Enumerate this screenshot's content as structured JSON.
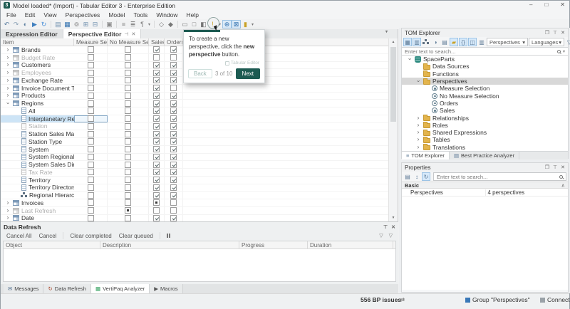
{
  "window": {
    "title": "Model loaded* (Import) - Tabular Editor 3 - Enterprise Edition",
    "controls": {
      "minimize": "–",
      "maximize": "□",
      "close": "✕"
    }
  },
  "menu": [
    "File",
    "Edit",
    "View",
    "Perspectives",
    "Model",
    "Tools",
    "Window",
    "Help"
  ],
  "toolbar": {
    "icons": [
      {
        "name": "undo",
        "glyph": "↶",
        "color": "#5b7ea0"
      },
      {
        "name": "redo",
        "glyph": "↷",
        "color": "#8aa0b5"
      },
      {
        "name": "compare-model",
        "glyph": "◐",
        "color": "#5b7ea0"
      },
      {
        "name": "deploy",
        "glyph": "▶",
        "color": "#3f7fbf"
      },
      {
        "name": "refresh-model",
        "glyph": "↻",
        "color": "#4a90d9"
      },
      {
        "sep": true
      },
      {
        "name": "new-measure",
        "glyph": "▤",
        "color": "#6f8fae"
      },
      {
        "name": "new-calculated-column",
        "glyph": "▦",
        "color": "#2f6fae"
      },
      {
        "name": "new-calculation-group",
        "glyph": "⊚",
        "color": "#888888"
      },
      {
        "name": "add-column",
        "glyph": "⊞",
        "color": "#6f8fae"
      },
      {
        "name": "new-table",
        "glyph": "⊟",
        "color": "#6f8fae"
      },
      {
        "sep": true
      },
      {
        "name": "copy",
        "glyph": "▣",
        "color": "#888888"
      },
      {
        "sep": true
      },
      {
        "name": "format-dax",
        "glyph": "≡",
        "color": "#888888"
      },
      {
        "name": "format-dax-long",
        "glyph": "≣",
        "color": "#888888"
      },
      {
        "name": "format-options",
        "glyph": "¶",
        "color": "#888888",
        "dropdown": true
      },
      {
        "sep": true
      },
      {
        "name": "job-queue",
        "glyph": "◇",
        "color": "#777777"
      },
      {
        "name": "import-tables",
        "glyph": "◆",
        "color": "#777777"
      },
      {
        "sep": true
      },
      {
        "name": "diagram-view",
        "glyph": "▭",
        "color": "#777777"
      },
      {
        "name": "pivot-grid",
        "glyph": "□",
        "color": "#777777"
      },
      {
        "name": "dax-query",
        "glyph": "◧",
        "color": "#777777"
      },
      {
        "name": "best-practice",
        "glyph": "!",
        "color": "#c9a227",
        "dropdown": true
      },
      {
        "name": "new-perspective",
        "glyph": "⊕",
        "color": "#2f6fae",
        "boxed": true,
        "circled": true
      },
      {
        "name": "new-translation",
        "glyph": "⊠",
        "color": "#2f6fae",
        "boxed": true
      },
      {
        "name": "macros",
        "glyph": "▮",
        "color": "#c9a227",
        "dropdown": true
      }
    ]
  },
  "editor_tabs": {
    "tabs": [
      {
        "label": "Expression Editor",
        "active": false
      },
      {
        "label": "Perspective Editor",
        "active": true,
        "pin": "⊣",
        "close": "✕"
      }
    ],
    "overflow_glyph": "▾"
  },
  "perspective_grid": {
    "columns": [
      "Item",
      "Measure Selection",
      "No Measure Selection",
      "Sales",
      "Orders"
    ],
    "rows": [
      {
        "label": "Brands",
        "icon": "table",
        "level": 0,
        "expander": "collapsed",
        "checks": [
          "u",
          "u",
          "c",
          "c"
        ]
      },
      {
        "label": "Budget Rate",
        "icon": "table",
        "level": 0,
        "expander": "collapsed",
        "gray": true,
        "checks": [
          "u",
          "u",
          "u",
          "u"
        ]
      },
      {
        "label": "Customers",
        "icon": "table",
        "level": 0,
        "expander": "collapsed",
        "checks": [
          "u",
          "u",
          "c",
          "c"
        ]
      },
      {
        "label": "Employees",
        "icon": "table",
        "level": 0,
        "expander": "collapsed",
        "gray": true,
        "checks": [
          "u",
          "u",
          "c",
          "c"
        ]
      },
      {
        "label": "Exchange Rate",
        "icon": "table",
        "level": 0,
        "expander": "collapsed",
        "checks": [
          "u",
          "u",
          "c",
          "c"
        ]
      },
      {
        "label": "Invoice Document Type",
        "icon": "table",
        "level": 0,
        "expander": "collapsed",
        "checks": [
          "u",
          "u",
          "c",
          "u"
        ]
      },
      {
        "label": "Products",
        "icon": "table",
        "level": 0,
        "expander": "collapsed",
        "checks": [
          "u",
          "u",
          "c",
          "c"
        ]
      },
      {
        "label": "Regions",
        "icon": "table",
        "level": 0,
        "expander": "expanded",
        "checks": [
          "u",
          "u",
          "c",
          "c"
        ]
      },
      {
        "label": "All",
        "icon": "column",
        "level": 1,
        "checks": [
          "u",
          "u",
          "c",
          "c"
        ]
      },
      {
        "label": "Interplanetary Region",
        "icon": "column",
        "level": 1,
        "selected": true,
        "checks": [
          "u",
          "u",
          "c",
          "c"
        ]
      },
      {
        "label": "Station",
        "icon": "column",
        "level": 1,
        "gray": true,
        "checks": [
          "u",
          "u",
          "c",
          "c"
        ]
      },
      {
        "label": "Station Sales Managers",
        "icon": "column",
        "level": 1,
        "checks": [
          "u",
          "u",
          "c",
          "c"
        ]
      },
      {
        "label": "Station Type",
        "icon": "column",
        "level": 1,
        "checks": [
          "u",
          "u",
          "c",
          "c"
        ]
      },
      {
        "label": "System",
        "icon": "column",
        "level": 1,
        "checks": [
          "u",
          "u",
          "c",
          "c"
        ]
      },
      {
        "label": "System Regional Managers",
        "icon": "column",
        "level": 1,
        "checks": [
          "u",
          "u",
          "c",
          "c"
        ]
      },
      {
        "label": "System Sales Directors",
        "icon": "column",
        "level": 1,
        "checks": [
          "u",
          "u",
          "c",
          "c"
        ]
      },
      {
        "label": "Tax Rate",
        "icon": "column",
        "level": 1,
        "gray": true,
        "checks": [
          "u",
          "u",
          "c",
          "c"
        ]
      },
      {
        "label": "Territory",
        "icon": "column",
        "level": 1,
        "checks": [
          "u",
          "u",
          "c",
          "c"
        ]
      },
      {
        "label": "Territory Directors",
        "icon": "column",
        "level": 1,
        "checks": [
          "u",
          "u",
          "c",
          "c"
        ]
      },
      {
        "label": "Regional Hierarchy",
        "icon": "hierarchy",
        "level": 1,
        "checks": [
          "u",
          "u",
          "c",
          "c"
        ]
      },
      {
        "label": "Invoices",
        "icon": "table",
        "level": 0,
        "expander": "collapsed",
        "checks": [
          "u",
          "u",
          "m",
          "u"
        ]
      },
      {
        "label": "Last Refresh",
        "icon": "table",
        "level": 0,
        "expander": "collapsed",
        "gray": true,
        "checks": [
          "u",
          "m",
          "u",
          "u"
        ]
      },
      {
        "label": "Date",
        "icon": "table",
        "level": 0,
        "expander": "collapsed",
        "checks": [
          "u",
          "u",
          "c",
          "c"
        ]
      }
    ]
  },
  "tour_popup": {
    "text_prefix": "To create a new perspective, click the ",
    "text_bold": "new perspective",
    "text_suffix": " button.",
    "watermark": "Tabular Editor",
    "back_label": "Back",
    "step_label": "3 of 10",
    "next_label": "Next",
    "progress_percent": 45,
    "accent_color": "#1d5b52"
  },
  "tom_explorer": {
    "title": "TOM Explorer",
    "window_icons": {
      "maximize": "❐",
      "pin": "⊤",
      "close": "✕"
    },
    "toolbar_icons": [
      {
        "name": "show-tables",
        "glyph": "▦",
        "active": true
      },
      {
        "name": "show-columns",
        "glyph": "▥",
        "active": true
      },
      {
        "name": "show-hierarchies",
        "glyph": "org",
        "active": false
      },
      {
        "name": "show-measures",
        "glyph": "◑",
        "active": false
      },
      {
        "name": "show-partitions",
        "glyph": "▤",
        "active": false
      },
      {
        "name": "show-folders",
        "glyph": "▰",
        "active": true,
        "color": "#c9a227"
      },
      {
        "name": "show-expressions",
        "glyph": "{}",
        "active": true
      },
      {
        "name": "show-perspectives",
        "glyph": "◫",
        "active": true
      },
      {
        "name": "column-chooser",
        "glyph": "▥",
        "active": false
      }
    ],
    "dropdowns": [
      {
        "label": "Perspectives",
        "caret": "▾"
      },
      {
        "label": "Languages",
        "caret": "▾"
      }
    ],
    "filter_glyph": "▽",
    "search_placeholder": "Enter text to search...",
    "tree": [
      {
        "label": "SpaceParts",
        "icon": "database",
        "level": 0,
        "expander": "expanded"
      },
      {
        "label": "Data Sources",
        "icon": "folder",
        "level": 1
      },
      {
        "label": "Functions",
        "icon": "folder",
        "level": 1
      },
      {
        "label": "Perspectives",
        "icon": "folder",
        "level": 1,
        "expander": "expanded",
        "selected": true
      },
      {
        "label": "Measure Selection",
        "icon": "perspective",
        "level": 2
      },
      {
        "label": "No Measure Selection",
        "icon": "perspective",
        "level": 2
      },
      {
        "label": "Orders",
        "icon": "perspective",
        "level": 2
      },
      {
        "label": "Sales",
        "icon": "perspective",
        "level": 2
      },
      {
        "label": "Relationships",
        "icon": "folder",
        "level": 1,
        "expander": "collapsed"
      },
      {
        "label": "Roles",
        "icon": "folder",
        "level": 1,
        "expander": "collapsed"
      },
      {
        "label": "Shared Expressions",
        "icon": "folder",
        "level": 1,
        "expander": "collapsed"
      },
      {
        "label": "Tables",
        "icon": "folder",
        "level": 1,
        "expander": "collapsed"
      },
      {
        "label": "Translations",
        "icon": "folder",
        "level": 1,
        "expander": "collapsed"
      }
    ],
    "tabs": [
      {
        "label": "TOM Explorer",
        "glyph": "≡",
        "active": true
      },
      {
        "label": "Best Practice Analyzer",
        "glyph": "▤",
        "active": false
      }
    ]
  },
  "properties": {
    "title": "Properties",
    "window_icons": {
      "maximize": "❐",
      "pin": "⊤",
      "close": "✕"
    },
    "toolbar_icons": [
      {
        "name": "categorized-view",
        "glyph": "▤"
      },
      {
        "name": "alphabetical-view",
        "glyph": "↕"
      },
      {
        "name": "refresh-properties",
        "glyph": "↻",
        "boxed": true
      }
    ],
    "search_placeholder": "Enter text to search...",
    "group_label": "Basic",
    "group_collapse_glyph": "∧",
    "rows": [
      {
        "name": "Perspectives",
        "value": "4 perspectives"
      }
    ]
  },
  "data_refresh": {
    "title": "Data Refresh",
    "window_icons": {
      "pin": "⊤",
      "close": "✕"
    },
    "actions": [
      "Cancel All",
      "Cancel",
      "|",
      "Clear completed",
      "Clear queued",
      "|",
      "pause"
    ],
    "right_icons": [
      "▽",
      "▽"
    ],
    "columns": [
      "Object",
      "Description",
      "Progress",
      "Duration"
    ]
  },
  "bottom_tabs": [
    {
      "label": "Messages",
      "glyph": "✉",
      "color": "#5d7a96",
      "active": false
    },
    {
      "label": "Data Refresh",
      "glyph": "↻",
      "color": "#b0543a",
      "active": false
    },
    {
      "label": "VertiPaq Analyzer",
      "glyph": "▦",
      "color": "#2e9e5b",
      "active": true
    },
    {
      "label": "Macros",
      "glyph": "▶",
      "color": "#555555",
      "active": false
    }
  ],
  "status_bar": {
    "bp_issues": "556 BP issues",
    "sync_glyph": "⇄",
    "group_label": "Group \"Perspectives\"",
    "connected_label": "Connected"
  }
}
